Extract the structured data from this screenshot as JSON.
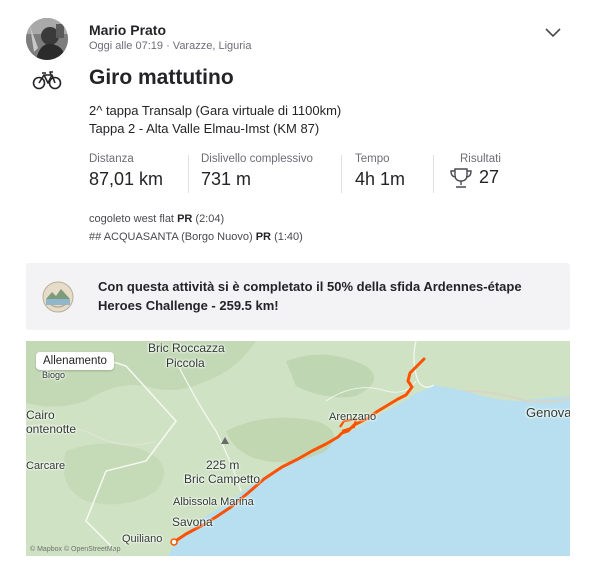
{
  "athlete": {
    "name": "Mario Prato",
    "time": "Oggi alle 07:19",
    "separator": "·",
    "location": "Varazze, Liguria"
  },
  "activity": {
    "sport_icon": "bike-icon",
    "title": "Giro mattutino",
    "description_line1": "2^ tappa Transalp (Gara virtuale di 1100km)",
    "description_line2": "Tappa 2 - Alta Valle Elmau-Imst (KM 87)"
  },
  "stats": [
    {
      "label": "Distanza",
      "value": "87,01 km"
    },
    {
      "label": "Dislivello complessivo",
      "value": "731 m"
    },
    {
      "label": "Tempo",
      "value": "4h 1m"
    },
    {
      "label": "Risultati",
      "value": "27"
    }
  ],
  "segments": [
    {
      "prefix": "",
      "name": "cogoleto west flat",
      "pr": "PR",
      "time": "(2:04)"
    },
    {
      "prefix": "## ",
      "name": "ACQUASANTA (Borgo Nuovo)",
      "pr": "PR",
      "time": "(1:40)"
    }
  ],
  "challenge": {
    "text": "Con questa attività si è completato il 50% della sfida Ardennes-étape Heroes Challenge - 259.5 km!"
  },
  "map": {
    "pill": "Allenamento",
    "route_color": "#fc5200",
    "labels": {
      "roccazza": "Bric Roccazza",
      "piccola": "Piccola",
      "cairo": "Cairo",
      "montenotte": "ontenotte",
      "carcare": "Carcare",
      "peak": "225 m",
      "campetto": "Bric Campetto",
      "albissola": "Albissola Marina",
      "savona": "Savona",
      "quiliano": "Quiliano",
      "arenzano": "Arenzano",
      "genova": "Genova",
      "biogo": "Biogo"
    },
    "attribution": "© Mapbox © OpenStreetMap"
  },
  "colors": {
    "text_primary": "#242428",
    "text_secondary": "#6d6d78",
    "challenge_bg": "#f3f3f6",
    "sea": "#b8dff0",
    "land": "#cfe2c4"
  }
}
